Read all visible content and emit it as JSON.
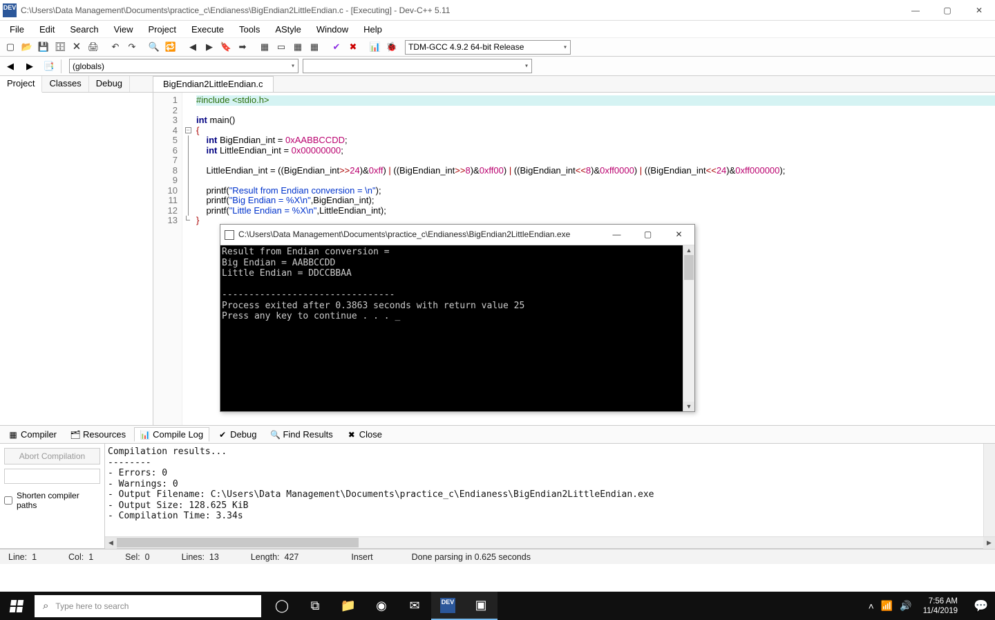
{
  "title": "C:\\Users\\Data Management\\Documents\\practice_c\\Endianess\\BigEndian2LittleEndian.c - [Executing] - Dev-C++ 5.11",
  "menu": [
    "File",
    "Edit",
    "Search",
    "View",
    "Project",
    "Execute",
    "Tools",
    "AStyle",
    "Window",
    "Help"
  ],
  "compiler_combo": "TDM-GCC 4.9.2 64-bit Release",
  "globals_combo": "(globals)",
  "left_tabs": [
    "Project",
    "Classes",
    "Debug"
  ],
  "editor_tab": "BigEndian2LittleEndian.c",
  "line_count": 13,
  "code": [
    {
      "indent": 0,
      "tokens": [
        [
          "pp",
          "#include <stdio.h>"
        ]
      ]
    },
    {
      "indent": 0,
      "tokens": []
    },
    {
      "indent": 0,
      "tokens": [
        [
          "kw",
          "int"
        ],
        [
          "plain",
          " main()"
        ]
      ]
    },
    {
      "indent": 0,
      "tokens": [
        [
          "br",
          "{"
        ]
      ]
    },
    {
      "indent": 1,
      "tokens": [
        [
          "kw",
          "int"
        ],
        [
          "plain",
          " BigEndian_int = "
        ],
        [
          "num",
          "0xAABBCCDD"
        ],
        [
          "plain",
          ";"
        ]
      ]
    },
    {
      "indent": 1,
      "tokens": [
        [
          "kw",
          "int"
        ],
        [
          "plain",
          " LittleEndian_int = "
        ],
        [
          "num",
          "0x00000000"
        ],
        [
          "plain",
          ";"
        ]
      ]
    },
    {
      "indent": 1,
      "tokens": []
    },
    {
      "indent": 1,
      "tokens": [
        [
          "plain",
          "LittleEndian_int = ((BigEndian_int"
        ],
        [
          "op",
          ">>"
        ],
        [
          "num",
          "24"
        ],
        [
          "plain",
          ")&"
        ],
        [
          "num",
          "0xff"
        ],
        [
          "plain",
          ") "
        ],
        [
          "op",
          "|"
        ],
        [
          "plain",
          " ((BigEndian_int"
        ],
        [
          "op",
          ">>"
        ],
        [
          "num",
          "8"
        ],
        [
          "plain",
          ")&"
        ],
        [
          "num",
          "0xff00"
        ],
        [
          "plain",
          ") "
        ],
        [
          "op",
          "|"
        ],
        [
          "plain",
          " ((BigEndian_int"
        ],
        [
          "op",
          "<<"
        ],
        [
          "num",
          "8"
        ],
        [
          "plain",
          ")&"
        ],
        [
          "num",
          "0xff0000"
        ],
        [
          "plain",
          ") "
        ],
        [
          "op",
          "|"
        ],
        [
          "plain",
          " ((BigEndian_int"
        ],
        [
          "op",
          "<<"
        ],
        [
          "num",
          "24"
        ],
        [
          "plain",
          ")&"
        ],
        [
          "num",
          "0xff000000"
        ],
        [
          "plain",
          ");"
        ]
      ]
    },
    {
      "indent": 1,
      "tokens": []
    },
    {
      "indent": 1,
      "tokens": [
        [
          "plain",
          "printf("
        ],
        [
          "str",
          "\"Result from Endian conversion = \\n\""
        ],
        [
          "plain",
          ");"
        ]
      ]
    },
    {
      "indent": 1,
      "tokens": [
        [
          "plain",
          "printf("
        ],
        [
          "str",
          "\"Big Endian = %X\\n\""
        ],
        [
          "plain",
          ",BigEndian_int);"
        ]
      ]
    },
    {
      "indent": 1,
      "tokens": [
        [
          "plain",
          "printf("
        ],
        [
          "str",
          "\"Little Endian = %X\\n\""
        ],
        [
          "plain",
          ",LittleEndian_int);"
        ]
      ]
    },
    {
      "indent": 0,
      "tokens": [
        [
          "br",
          "}"
        ]
      ]
    }
  ],
  "console": {
    "title": "C:\\Users\\Data Management\\Documents\\practice_c\\Endianess\\BigEndian2LittleEndian.exe",
    "lines": [
      "Result from Endian conversion =",
      "Big Endian = AABBCCDD",
      "Little Endian = DDCCBBAA",
      "",
      "--------------------------------",
      "Process exited after 0.3863 seconds with return value 25",
      "Press any key to continue . . . _"
    ]
  },
  "bottom_tabs": [
    {
      "icon": "▦",
      "label": "Compiler"
    },
    {
      "icon": "🗂",
      "label": "Resources"
    },
    {
      "icon": "📊",
      "label": "Compile Log"
    },
    {
      "icon": "✔",
      "label": "Debug"
    },
    {
      "icon": "🔍",
      "label": "Find Results"
    },
    {
      "icon": "✖",
      "label": "Close"
    }
  ],
  "active_bottom_tab": 2,
  "abort_button": "Abort Compilation",
  "shorten_label": "Shorten compiler paths",
  "compile_log": "Compilation results...\n--------\n- Errors: 0\n- Warnings: 0\n- Output Filename: C:\\Users\\Data Management\\Documents\\practice_c\\Endianess\\BigEndian2LittleEndian.exe\n- Output Size: 128.625 KiB\n- Compilation Time: 3.34s",
  "status": {
    "line_label": "Line:",
    "line": "1",
    "col_label": "Col:",
    "col": "1",
    "sel_label": "Sel:",
    "sel": "0",
    "lines_label": "Lines:",
    "lines": "13",
    "len_label": "Length:",
    "len": "427",
    "mode": "Insert",
    "msg": "Done parsing in 0.625 seconds"
  },
  "taskbar": {
    "search_placeholder": "Type here to search",
    "time": "7:56 AM",
    "date": "11/4/2019"
  }
}
